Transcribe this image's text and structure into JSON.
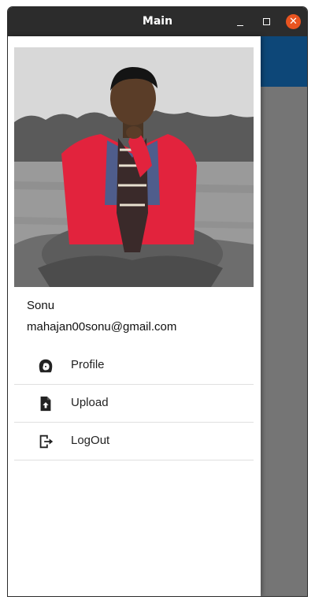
{
  "window": {
    "title": "Main",
    "minimize_icon": "minimize-icon",
    "maximize_icon": "maximize-icon",
    "close_icon": "close-icon",
    "close_color": "#e95420"
  },
  "app": {
    "appbar_color": "#0d4778",
    "scrim_color": "#757575"
  },
  "drawer": {
    "profile_photo": "user-photo",
    "user_name": "Sonu",
    "user_email": "mahajan00sonu@gmail.com",
    "items": [
      {
        "label": "Profile",
        "icon": "face-icon"
      },
      {
        "label": "Upload",
        "icon": "upload-file-icon"
      },
      {
        "label": "LogOut",
        "icon": "logout-icon"
      }
    ]
  }
}
